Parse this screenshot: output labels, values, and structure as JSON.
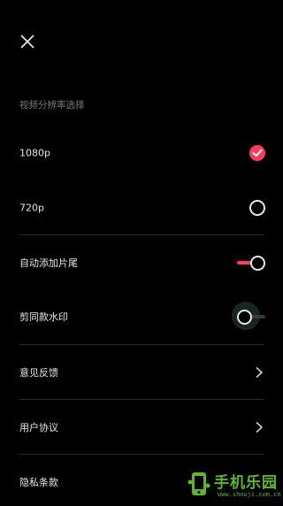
{
  "header": {
    "close_icon": "close-icon"
  },
  "resolution": {
    "title": "视频分辨率选择",
    "options": [
      {
        "label": "1080p",
        "selected": true
      },
      {
        "label": "720p",
        "selected": false
      }
    ]
  },
  "settings": {
    "auto_add_ending": {
      "label": "自动添加片尾",
      "on": true
    },
    "capcut_watermark": {
      "label": "剪同款水印",
      "on": false
    }
  },
  "links": {
    "feedback": "意见反馈",
    "user_agreement": "用户协议",
    "privacy_policy": "隐私条款"
  },
  "watermark": {
    "text": "手机乐园",
    "sub": "www.shouji.com.cn"
  },
  "colors": {
    "accent": "#ff3b5c",
    "background": "#000000",
    "watermark": "#5fb52a"
  }
}
